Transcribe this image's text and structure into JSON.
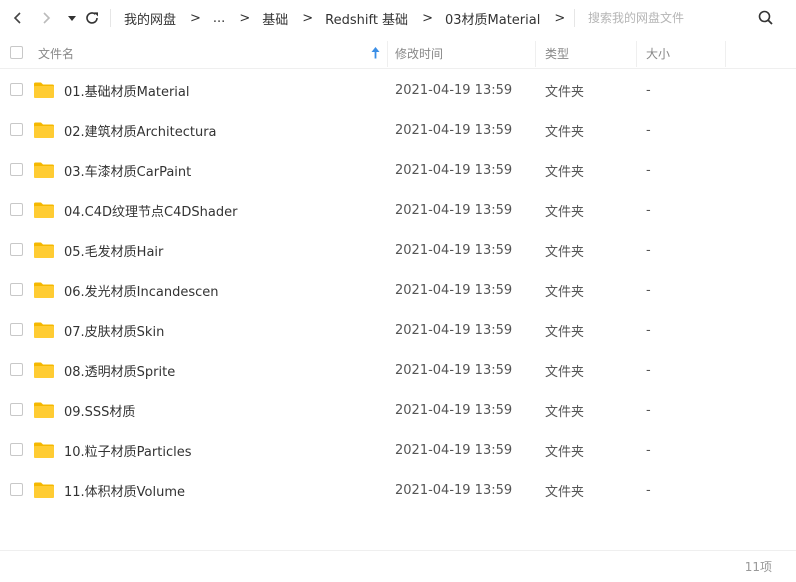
{
  "nav": {
    "back_icon": "chevron-left-icon",
    "forward_icon": "chevron-right-icon",
    "dropdown_icon": "caret-down-icon",
    "refresh_icon": "refresh-icon"
  },
  "breadcrumb": [
    "我的网盘",
    "...",
    "基础",
    "Redshift 基础",
    "03材质Material"
  ],
  "breadcrumb_separator": ">",
  "search": {
    "placeholder": "搜索我的网盘文件",
    "icon": "search-icon"
  },
  "columns": {
    "name": "文件名",
    "modified": "修改时间",
    "type": "类型",
    "size": "大小"
  },
  "files": [
    {
      "name": "01.基础材质Material",
      "modified": "2021-04-19 13:59",
      "type": "文件夹",
      "size": "-"
    },
    {
      "name": "02.建筑材质Architectura",
      "modified": "2021-04-19 13:59",
      "type": "文件夹",
      "size": "-"
    },
    {
      "name": "03.车漆材质CarPaint",
      "modified": "2021-04-19 13:59",
      "type": "文件夹",
      "size": "-"
    },
    {
      "name": "04.C4D纹理节点C4DShader",
      "modified": "2021-04-19 13:59",
      "type": "文件夹",
      "size": "-"
    },
    {
      "name": "05.毛发材质Hair",
      "modified": "2021-04-19 13:59",
      "type": "文件夹",
      "size": "-"
    },
    {
      "name": "06.发光材质Incandescen",
      "modified": "2021-04-19 13:59",
      "type": "文件夹",
      "size": "-"
    },
    {
      "name": "07.皮肤材质Skin",
      "modified": "2021-04-19 13:59",
      "type": "文件夹",
      "size": "-"
    },
    {
      "name": "08.透明材质Sprite",
      "modified": "2021-04-19 13:59",
      "type": "文件夹",
      "size": "-"
    },
    {
      "name": "09.SSS材质",
      "modified": "2021-04-19 13:59",
      "type": "文件夹",
      "size": "-"
    },
    {
      "name": "10.粒子材质Particles",
      "modified": "2021-04-19 13:59",
      "type": "文件夹",
      "size": "-"
    },
    {
      "name": "11.体积材质Volume",
      "modified": "2021-04-19 13:59",
      "type": "文件夹",
      "size": "-"
    }
  ],
  "footer": {
    "count": "11项"
  },
  "colors": {
    "folder": "#ffcc33",
    "folder_back": "#f5b800",
    "sort_accent": "#3a8ee6"
  }
}
